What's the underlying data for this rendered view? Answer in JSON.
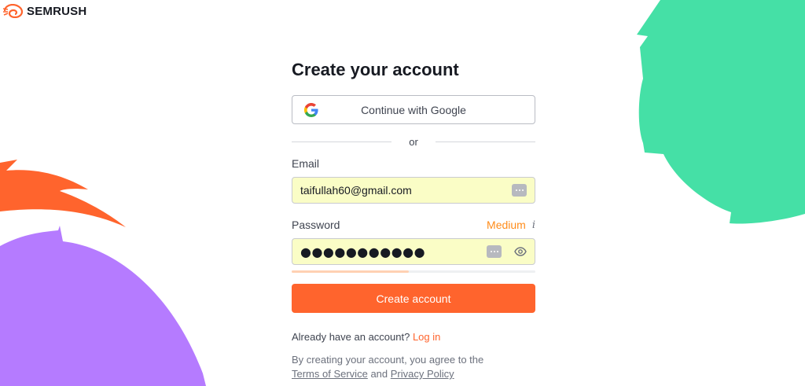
{
  "brand": {
    "name": "SEMRUSH"
  },
  "form": {
    "title": "Create your account",
    "google_label": "Continue with Google",
    "divider": "or",
    "email_label": "Email",
    "email_value": "taifullah60@gmail.com",
    "password_label": "Password",
    "password_strength": "Medium",
    "password_strength_level": 0.48,
    "password_masked": "●●●●●●●●●●●",
    "info_glyph": "i",
    "submit_label": "Create account",
    "login_prompt": "Already have an account?",
    "login_link": "Log in",
    "terms_prefix": "By creating your account, you agree to the",
    "terms_link": "Terms of Service",
    "terms_and": "and",
    "privacy_link": "Privacy Policy"
  },
  "colors": {
    "accent": "#ff642d",
    "strength_medium": "#ff8c1a",
    "autofill_bg": "#fafdc6",
    "deco_green": "#45e0a6",
    "deco_purple": "#b57bff",
    "deco_orange": "#ff642d"
  },
  "icons": {
    "google": "google-g-icon",
    "password_manager": "password-manager-key-icon",
    "show_password": "eye-icon",
    "info": "info-icon"
  }
}
